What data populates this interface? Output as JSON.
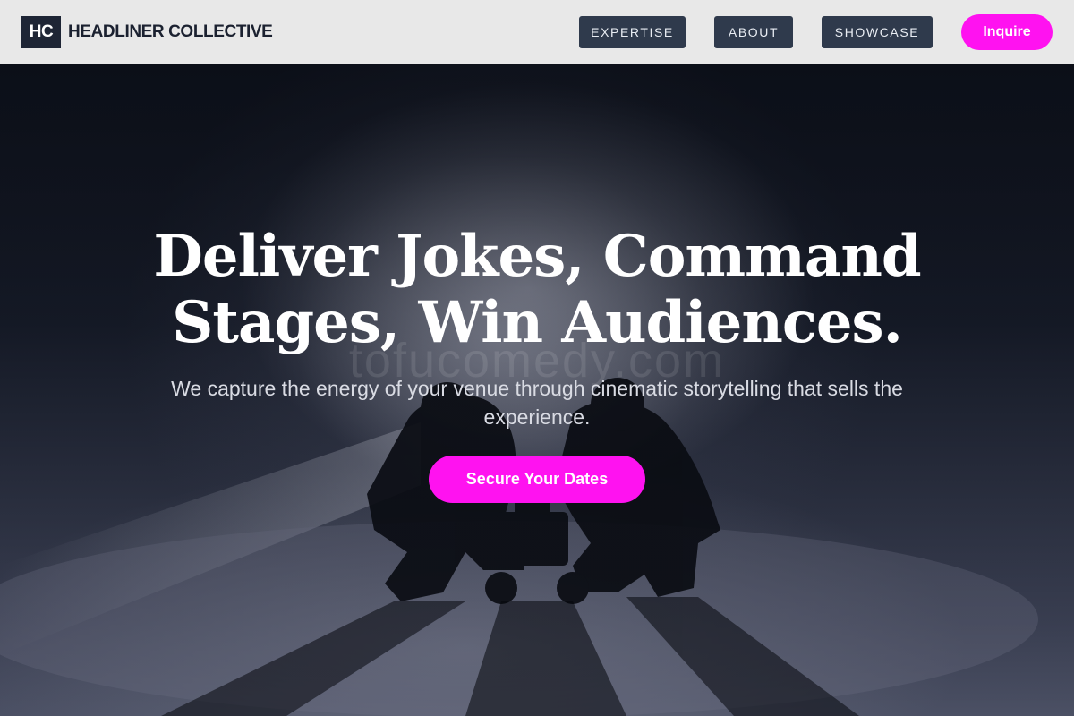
{
  "brand": {
    "mark": "HC",
    "name": "HEADLINER COLLECTIVE"
  },
  "nav": {
    "items": [
      {
        "label": "EXPERTISE"
      },
      {
        "label": "ABOUT"
      },
      {
        "label": "SHOWCASE"
      }
    ],
    "inquire_label": "Inquire"
  },
  "hero": {
    "title_line1": "Deliver Jokes, Command",
    "title_line2": "Stages, Win Audiences.",
    "watermark": "tofucomedy.com",
    "subtitle": "We capture the energy of your venue through cinematic storytelling that sells the experience.",
    "cta_label": "Secure Your Dates"
  },
  "colors": {
    "accent": "#ff12f0",
    "header_bg": "#e8e8e8",
    "nav_button_bg": "#2f3a4c",
    "brand_dark": "#1e2535",
    "hero_dark": "#0f131c"
  },
  "icons": {
    "hero_image": "camera-crew-silhouette-image"
  }
}
